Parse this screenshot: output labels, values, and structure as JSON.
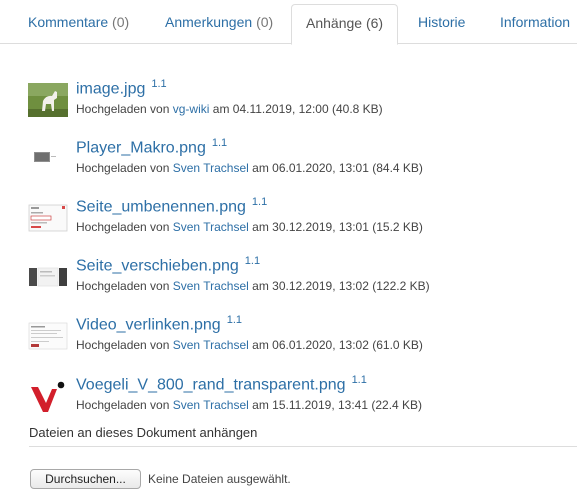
{
  "tabs": [
    {
      "label": "Kommentare",
      "count": "(0)",
      "active": false
    },
    {
      "label": "Anmerkungen",
      "count": "(0)",
      "active": false
    },
    {
      "label": "Anhänge",
      "count": "(6)",
      "active": true
    },
    {
      "label": "Historie",
      "count": "",
      "active": false
    },
    {
      "label": "Information",
      "count": "",
      "active": false
    }
  ],
  "attachments": [
    {
      "name": "image.jpg",
      "version": "1.1",
      "uploaded_by_prefix": "Hochgeladen von",
      "user": "vg-wiki",
      "date_text": "am 04.11.2019, 12:00 (40.8 KB)",
      "thumb_icon": "horse-photo-thumbnail"
    },
    {
      "name": "Player_Makro.png",
      "version": "1.1",
      "uploaded_by_prefix": "Hochgeladen von",
      "user": "Sven Trachsel",
      "date_text": "am 06.01.2020, 13:01 (84.4 KB)",
      "thumb_icon": "screenshot-thumbnail"
    },
    {
      "name": "Seite_umbenennen.png",
      "version": "1.1",
      "uploaded_by_prefix": "Hochgeladen von",
      "user": "Sven Trachsel",
      "date_text": "am 30.12.2019, 13:01 (15.2 KB)",
      "thumb_icon": "dialog-screenshot-thumbnail"
    },
    {
      "name": "Seite_verschieben.png",
      "version": "1.1",
      "uploaded_by_prefix": "Hochgeladen von",
      "user": "Sven Trachsel",
      "date_text": "am 30.12.2019, 13:02 (122.2 KB)",
      "thumb_icon": "page-screenshot-thumbnail"
    },
    {
      "name": "Video_verlinken.png",
      "version": "1.1",
      "uploaded_by_prefix": "Hochgeladen von",
      "user": "Sven Trachsel",
      "date_text": "am 06.01.2020, 13:02 (61.0 KB)",
      "thumb_icon": "form-screenshot-thumbnail"
    },
    {
      "name": "Voegeli_V_800_rand_transparent.png",
      "version": "1.1",
      "uploaded_by_prefix": "Hochgeladen von",
      "user": "Sven Trachsel",
      "date_text": "am 15.11.2019, 13:41 (22.4 KB)",
      "thumb_icon": "voegeli-logo-thumbnail"
    }
  ],
  "upload": {
    "title": "Dateien an dieses Dokument anhängen",
    "browse_label": "Durchsuchen...",
    "no_file_text": "Keine Dateien ausgewählt."
  },
  "colors": {
    "link": "#2d6fa6",
    "logo_red": "#d21f2b",
    "border": "#dddddd"
  }
}
